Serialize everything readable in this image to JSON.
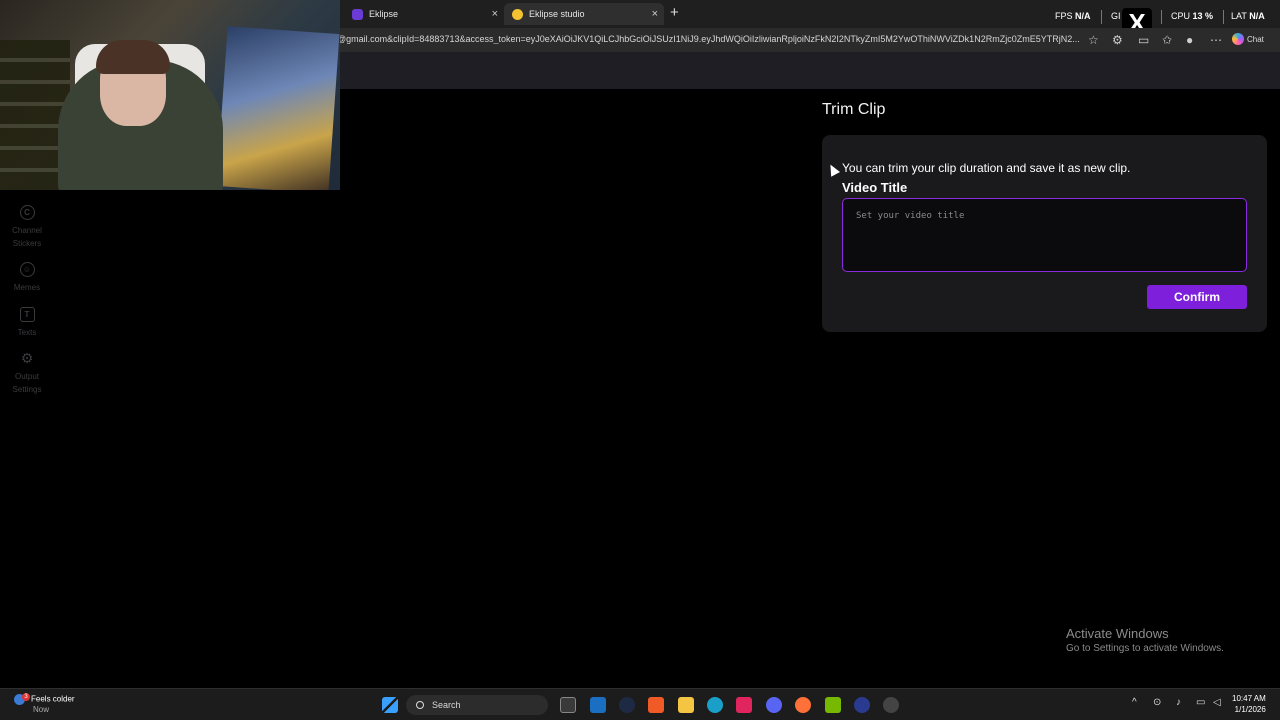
{
  "browser": {
    "tabs": [
      {
        "label": "Eklipse",
        "active": false
      },
      {
        "label": "Eklipse studio",
        "active": true
      }
    ],
    "new_tab": "+",
    "close_glyph": "×",
    "url": "@gmail.com&clipId=84883713&access_token=eyJ0eXAiOiJKV1QiLCJhbGciOiJSUzI1NiJ9.eyJhdWQiOiIzliwianRpljoiNzFkN2I2NTkyZmI5M2YwOThiNWViZDk1N2RmZjc0ZmE5YTRjN2...",
    "chat_label": "Chat"
  },
  "overlay": {
    "fps_label": "FPS",
    "fps_value": "N/A",
    "gpu_label": "GI",
    "cpu_label": "CPU",
    "cpu_value": "13 %",
    "lat_label": "LAT",
    "lat_value": "N/A"
  },
  "sidenav": {
    "items": [
      {
        "label": "Channel Stickers",
        "icon": "channel-stickers-icon",
        "glyph": "C"
      },
      {
        "label": "Memes",
        "icon": "memes-icon",
        "glyph": "☺"
      },
      {
        "label": "Texts",
        "icon": "texts-icon",
        "glyph": "T"
      },
      {
        "label": "Output Settings",
        "icon": "gear-icon",
        "glyph": "⚙"
      }
    ]
  },
  "trim": {
    "title": "Trim Clip",
    "info": "You can trim your clip duration and save it as new clip.",
    "field_label": "Video Title",
    "placeholder": "Set your video title",
    "value": "",
    "confirm": "Confirm"
  },
  "watermark": {
    "line1": "Activate Windows",
    "line2": "Go to Settings to activate Windows."
  },
  "taskbar": {
    "weather_title": "Feels colder",
    "weather_sub": "Now",
    "notification_count": "3",
    "search_label": "Search",
    "time": "10:47 AM",
    "date": "1/1/2026"
  },
  "colors": {
    "accent": "#7e1fdc",
    "input_border": "#8a2be2",
    "card_bg": "#1a1a1d",
    "page_bg": "#000000"
  }
}
